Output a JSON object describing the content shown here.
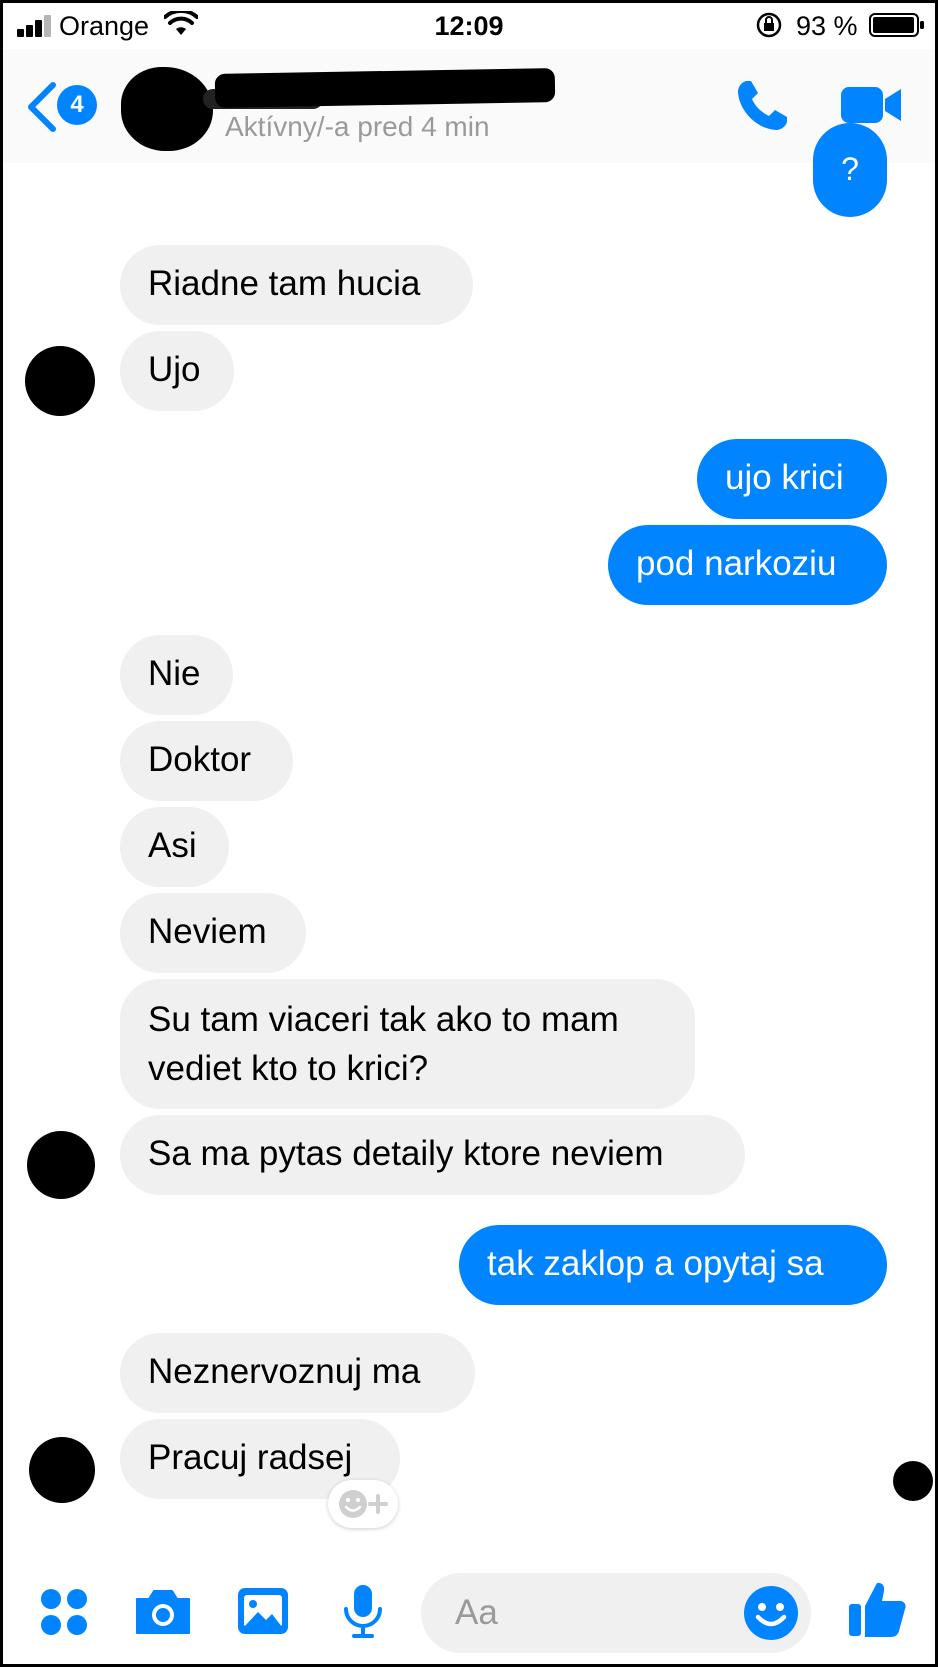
{
  "status_bar": {
    "carrier": "Orange",
    "time": "12:09",
    "battery": "93 %"
  },
  "header": {
    "back_badge": "4",
    "status": "Aktívny/-a pred 4 min"
  },
  "messages": [
    {
      "side": "out",
      "text": "?"
    },
    {
      "side": "in",
      "text": "Riadne tam hucia"
    },
    {
      "side": "in",
      "text": "Ujo"
    },
    {
      "side": "out",
      "text": "ujo krici"
    },
    {
      "side": "out",
      "text": "pod narkoziu"
    },
    {
      "side": "in",
      "text": "Nie"
    },
    {
      "side": "in",
      "text": "Doktor"
    },
    {
      "side": "in",
      "text": "Asi"
    },
    {
      "side": "in",
      "text": "Neviem"
    },
    {
      "side": "in",
      "text": "Su tam viaceri tak ako to mam\nvediet kto to krici?"
    },
    {
      "side": "in",
      "text": "Sa ma pytas detaily ktore neviem"
    },
    {
      "side": "out",
      "text": "tak zaklop a opytaj sa"
    },
    {
      "side": "in",
      "text": "Neznervoznuj ma"
    },
    {
      "side": "in",
      "text": "Pracuj radsej"
    }
  ],
  "composer": {
    "placeholder": "Aa"
  },
  "colors": {
    "accent": "#0084ff",
    "incoming_bubble": "#f0f0f0"
  },
  "icons": [
    "signal-icon",
    "wifi-icon",
    "rotation-lock-icon",
    "battery-icon",
    "back-chevron-icon",
    "phone-icon",
    "video-icon",
    "apps-icon",
    "camera-icon",
    "gallery-icon",
    "microphone-icon",
    "emoji-icon",
    "like-icon",
    "add-reaction-icon"
  ]
}
